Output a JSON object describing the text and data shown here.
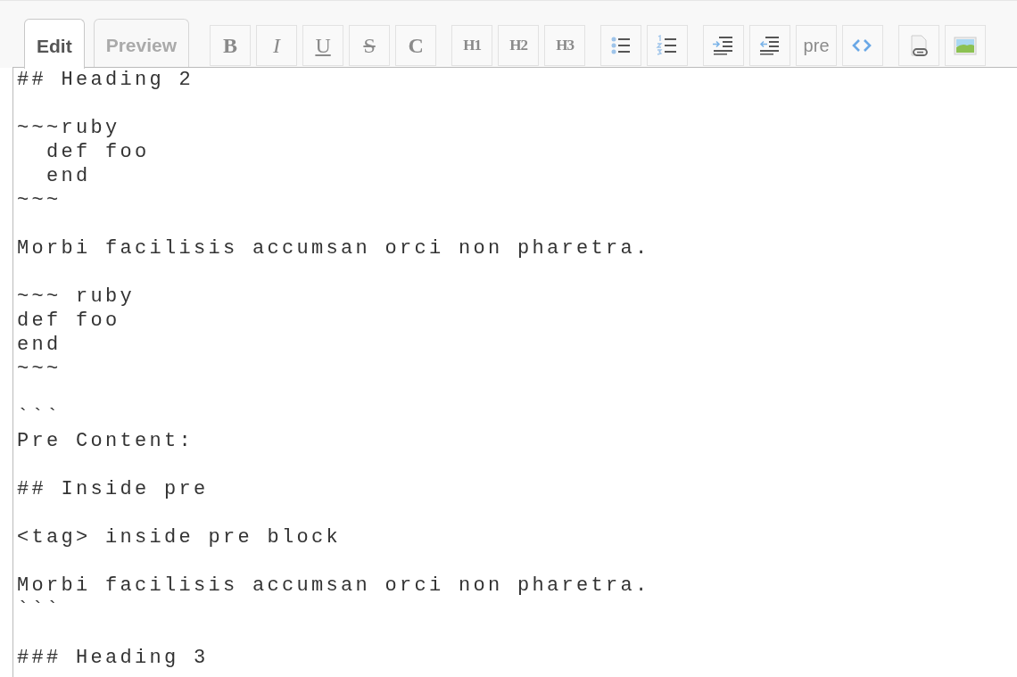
{
  "tabs": [
    {
      "label": "Edit",
      "selected": true
    },
    {
      "label": "Preview",
      "selected": false
    }
  ],
  "toolbar": [
    [
      {
        "kind": "bold",
        "label": "B"
      },
      {
        "kind": "italic",
        "label": "I"
      },
      {
        "kind": "underline",
        "label": "U"
      },
      {
        "kind": "strike",
        "label": "S"
      },
      {
        "kind": "code",
        "label": "C"
      }
    ],
    [
      {
        "kind": "heading",
        "label": "H1"
      },
      {
        "kind": "heading",
        "label": "H2"
      },
      {
        "kind": "heading",
        "label": "H3"
      }
    ],
    [
      {
        "kind": "bullet_list"
      },
      {
        "kind": "numbered_list"
      }
    ],
    [
      {
        "kind": "indent"
      },
      {
        "kind": "outdent"
      },
      {
        "kind": "pre",
        "label": "pre"
      },
      {
        "kind": "code_tag"
      }
    ],
    [
      {
        "kind": "link_file"
      },
      {
        "kind": "image"
      }
    ]
  ],
  "editor": {
    "value": "## Heading 2\n\n~~~ruby\n  def foo\n  end\n~~~\n\nMorbi facilisis accumsan orci non pharetra.\n\n~~~ ruby\ndef foo\nend\n~~~\n\n```\nPre Content:\n\n## Inside pre\n\n<tag> inside pre block\n\nMorbi facilisis accumsan orci non pharetra.\n```\n\n### Heading 3"
  }
}
